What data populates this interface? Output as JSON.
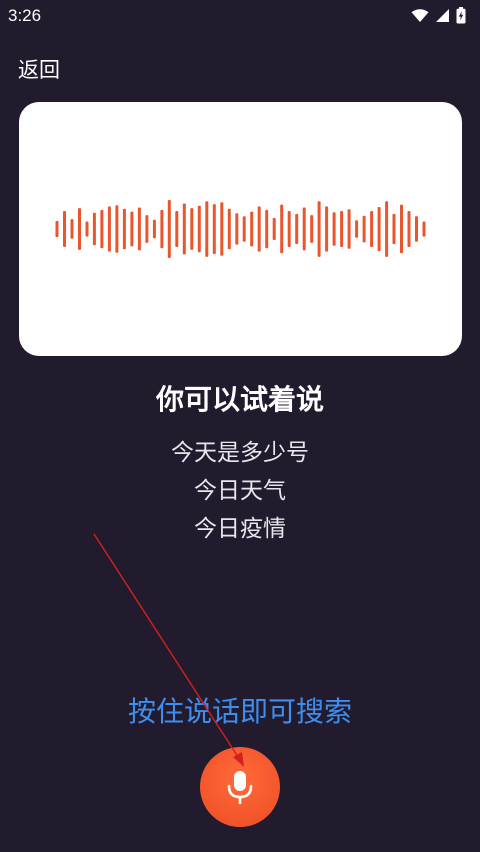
{
  "status_bar": {
    "time": "3:26",
    "icons": [
      "wifi-icon",
      "cellular-signal-icon",
      "battery-charging-icon"
    ]
  },
  "header": {
    "back_label": "返回"
  },
  "waveform": {
    "bar_color": "#e9552c",
    "levels": [
      0.28,
      0.62,
      0.34,
      0.72,
      0.26,
      0.56,
      0.66,
      0.78,
      0.82,
      0.7,
      0.6,
      0.74,
      0.48,
      0.32,
      0.66,
      1.0,
      0.62,
      0.88,
      0.72,
      0.8,
      0.96,
      0.86,
      0.92,
      0.7,
      0.54,
      0.44,
      0.6,
      0.78,
      0.66,
      0.38,
      0.84,
      0.62,
      0.52,
      0.74,
      0.48,
      0.96,
      0.78,
      0.58,
      0.62,
      0.68,
      0.3,
      0.46,
      0.62,
      0.76,
      0.96,
      0.52,
      0.84,
      0.62,
      0.44,
      0.26
    ]
  },
  "prompt": {
    "title": "你可以试着说",
    "suggestions": [
      "今天是多少号",
      "今日天气",
      "今日疫情"
    ]
  },
  "voice_search": {
    "hint": "按住说话即可搜索",
    "mic_icon": "microphone-icon"
  },
  "colors": {
    "background": "#221b2e",
    "accent_blue": "#3d8ef0",
    "mic_orange": "#f2552a",
    "annotation_arrow": "#d42020"
  }
}
